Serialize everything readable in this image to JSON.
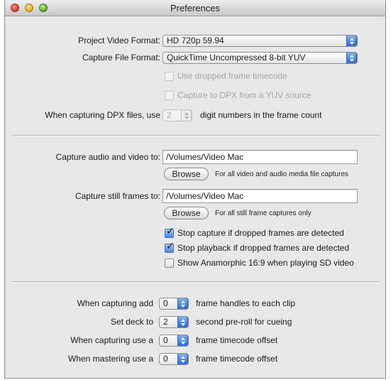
{
  "window": {
    "title": "Preferences"
  },
  "format": {
    "project_label": "Project Video Format:",
    "project_value": "HD 720p 59.94",
    "capture_label": "Capture File Format:",
    "capture_value": "QuickTime Uncompressed 8-bit YUV",
    "dropped_tc": {
      "label": "Use dropped frame timecode",
      "checked": false,
      "enabled": false
    },
    "capture_dpx": {
      "label": "Capture to DPX from a YUV source",
      "checked": false,
      "enabled": false
    },
    "dpx_prefix": "When capturing DPX files, use",
    "dpx_digits": "2",
    "dpx_suffix": "digit numbers in the frame count"
  },
  "capture": {
    "av_label": "Capture audio and video to:",
    "av_path": "/Volumes/Video Mac",
    "browse_label": "Browse",
    "av_note": "For all video and audio media file captures",
    "still_label": "Capture still frames to:",
    "still_path": "/Volumes/Video Mac",
    "still_note": "For all still frame captures only",
    "stop_capture": {
      "label": "Stop capture if dropped frames are detected",
      "checked": true
    },
    "stop_playback": {
      "label": "Stop playback if dropped frames are detected",
      "checked": true
    },
    "anamorphic": {
      "label": "Show Anamorphic 16:9 when playing SD video",
      "checked": false
    }
  },
  "timing": {
    "handles_prefix": "When capturing add",
    "handles_value": "0",
    "handles_suffix": "frame handles to each clip",
    "preroll_prefix": "Set deck to",
    "preroll_value": "2",
    "preroll_suffix": "second pre-roll for cueing",
    "cap_offset_prefix": "When capturing use a",
    "cap_offset_value": "0",
    "cap_offset_suffix": "frame timecode offset",
    "master_offset_prefix": "When mastering use a",
    "master_offset_value": "0",
    "master_offset_suffix": "frame timecode offset"
  },
  "colors": {
    "accent": "#3a74d6",
    "window_bg": "#e8e8e8"
  }
}
